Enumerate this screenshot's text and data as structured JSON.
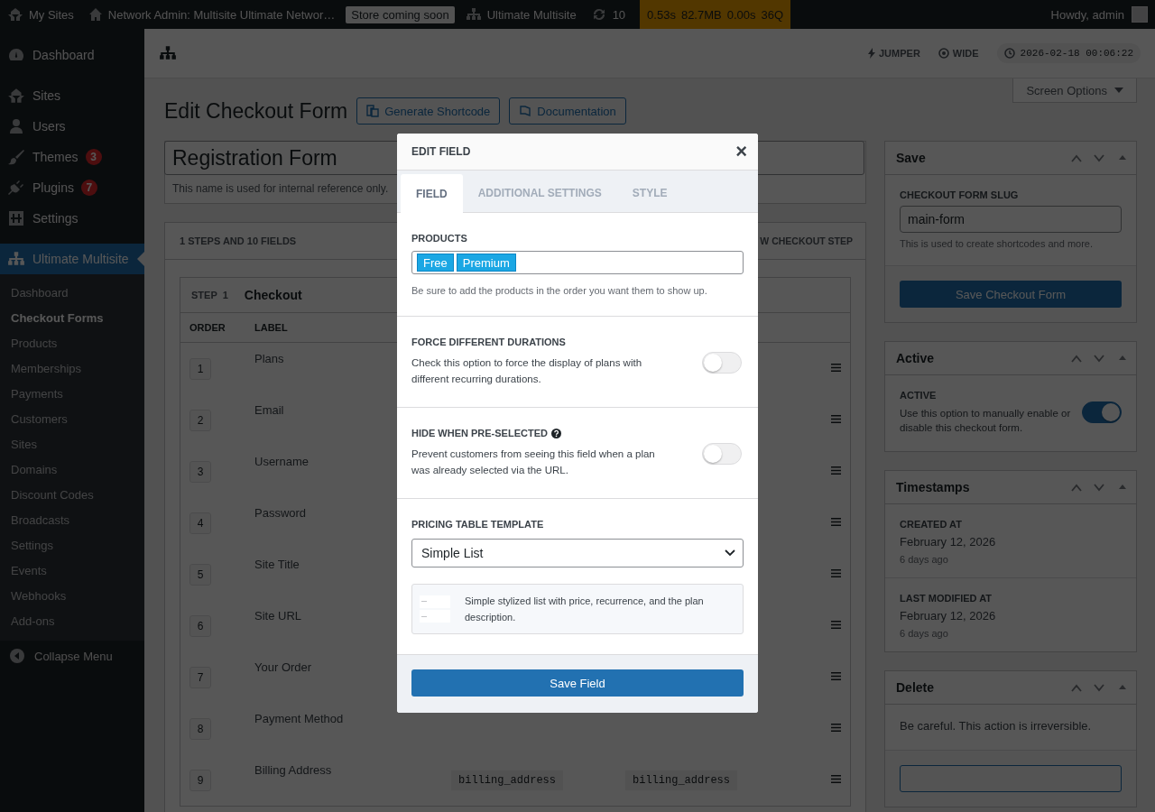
{
  "admin_bar": {
    "items": [
      {
        "kind": "sites",
        "label": "My Sites"
      },
      {
        "kind": "home",
        "label": "Network Admin: Multisite Ultimate Networ…"
      },
      {
        "kind": "badge",
        "label": "Store coming soon"
      },
      {
        "kind": "network",
        "label": "Ultimate Multisite"
      },
      {
        "kind": "updates",
        "label": "10"
      }
    ],
    "perf": [
      "0.53s",
      "82.7MB",
      "0.00s",
      "36Q"
    ],
    "greeting": "Howdy, admin"
  },
  "menu": [
    {
      "label": "Dashboard",
      "selected": false
    },
    {
      "label": "Sites",
      "selected": false
    },
    {
      "label": "Users",
      "selected": false
    },
    {
      "label": "Themes",
      "badge": "3",
      "selected": false
    },
    {
      "label": "Plugins",
      "badge": "7",
      "selected": false
    },
    {
      "label": "Settings",
      "selected": false
    },
    {
      "label": "Ultimate Multisite",
      "selected": true
    }
  ],
  "submenu": [
    {
      "label": "Dashboard",
      "selected": false
    },
    {
      "label": "Checkout Forms",
      "selected": true
    },
    {
      "label": "Products",
      "selected": false
    },
    {
      "label": "Memberships",
      "selected": false
    },
    {
      "label": "Payments",
      "selected": false
    },
    {
      "label": "Customers",
      "selected": false
    },
    {
      "label": "Sites",
      "selected": false
    },
    {
      "label": "Domains",
      "selected": false
    },
    {
      "label": "Discount Codes",
      "selected": false
    },
    {
      "label": "Broadcasts",
      "selected": false
    },
    {
      "label": "Settings",
      "selected": false
    },
    {
      "label": "Events",
      "selected": false
    },
    {
      "label": "Webhooks",
      "selected": false
    },
    {
      "label": "Add-ons",
      "selected": false
    }
  ],
  "collapse": "Collapse Menu",
  "toolbar": {
    "jumper": "JUMPER",
    "wide": "WIDE",
    "clock": "2026-02-18 00:06:22",
    "screen_options": "Screen Options"
  },
  "page": {
    "title": "Edit Checkout Form",
    "buttons": [
      "Generate Shortcode",
      "Documentation"
    ]
  },
  "name_field": {
    "value": "Registration Form",
    "help": "This name is used for internal reference only."
  },
  "steps_card": {
    "summary": "1 STEPS AND 10 FIELDS",
    "action": "W CHECKOUT STEP",
    "step": {
      "label": "STEP",
      "number": "1",
      "title": "Checkout"
    },
    "columns": [
      "ORDER",
      "LABEL"
    ],
    "rows": [
      {
        "order": "1",
        "label": "Plans"
      },
      {
        "order": "2",
        "label": "Email"
      },
      {
        "order": "3",
        "label": "Username"
      },
      {
        "order": "4",
        "label": "Password"
      },
      {
        "order": "5",
        "label": "Site Title"
      },
      {
        "order": "6",
        "label": "Site URL"
      },
      {
        "order": "7",
        "label": "Your Order"
      },
      {
        "order": "8",
        "label": "Payment Method"
      },
      {
        "order": "9",
        "label": "Billing Address",
        "column_3": "billing_address",
        "column_4": "billing_address"
      }
    ]
  },
  "modal": {
    "title": "EDIT FIELD",
    "close": "×",
    "tabs": [
      {
        "label": "FIELD",
        "selected": true
      },
      {
        "label": "ADDITIONAL SETTINGS",
        "selected": false
      },
      {
        "label": "STYLE",
        "selected": false
      }
    ],
    "products": {
      "label": "PRODUCTS",
      "tags": [
        "Free",
        "Premium"
      ],
      "help": "Be sure to add the products in the order you want them to show up."
    },
    "toggles": [
      {
        "label": "FORCE DIFFERENT DURATIONS",
        "help_icon": false,
        "description": "Check this option to force the display of plans with different recurring durations.",
        "checked": false
      },
      {
        "label": "HIDE WHEN PRE-SELECTED",
        "help_icon": true,
        "description": "Prevent customers from seeing this field when a plan was already selected via the URL.",
        "checked": false
      }
    ],
    "template": {
      "label": "PRICING TABLE TEMPLATE",
      "value": "Simple List",
      "description": "Simple stylized list with price, recurrence, and the plan description."
    },
    "save": "Save Field"
  },
  "boxes": {
    "save": {
      "title": "Save",
      "slug_label": "CHECKOUT FORM SLUG",
      "slug": "main-form",
      "help": "This is used to create shortcodes and more.",
      "button": "Save Checkout Form"
    },
    "active": {
      "title": "Active",
      "label": "ACTIVE",
      "description": "Use this option to manually enable or disable this checkout form.",
      "checked": true
    },
    "timestamps": {
      "title": "Timestamps",
      "entries": [
        {
          "label": "CREATED AT",
          "date": "February 12, 2026",
          "ago": "6 days ago"
        },
        {
          "label": "LAST MODIFIED AT",
          "date": "February 12, 2026",
          "ago": "6 days ago"
        }
      ]
    },
    "delete": {
      "title": "Delete",
      "warning": "Be careful. This action is irreversible."
    }
  }
}
